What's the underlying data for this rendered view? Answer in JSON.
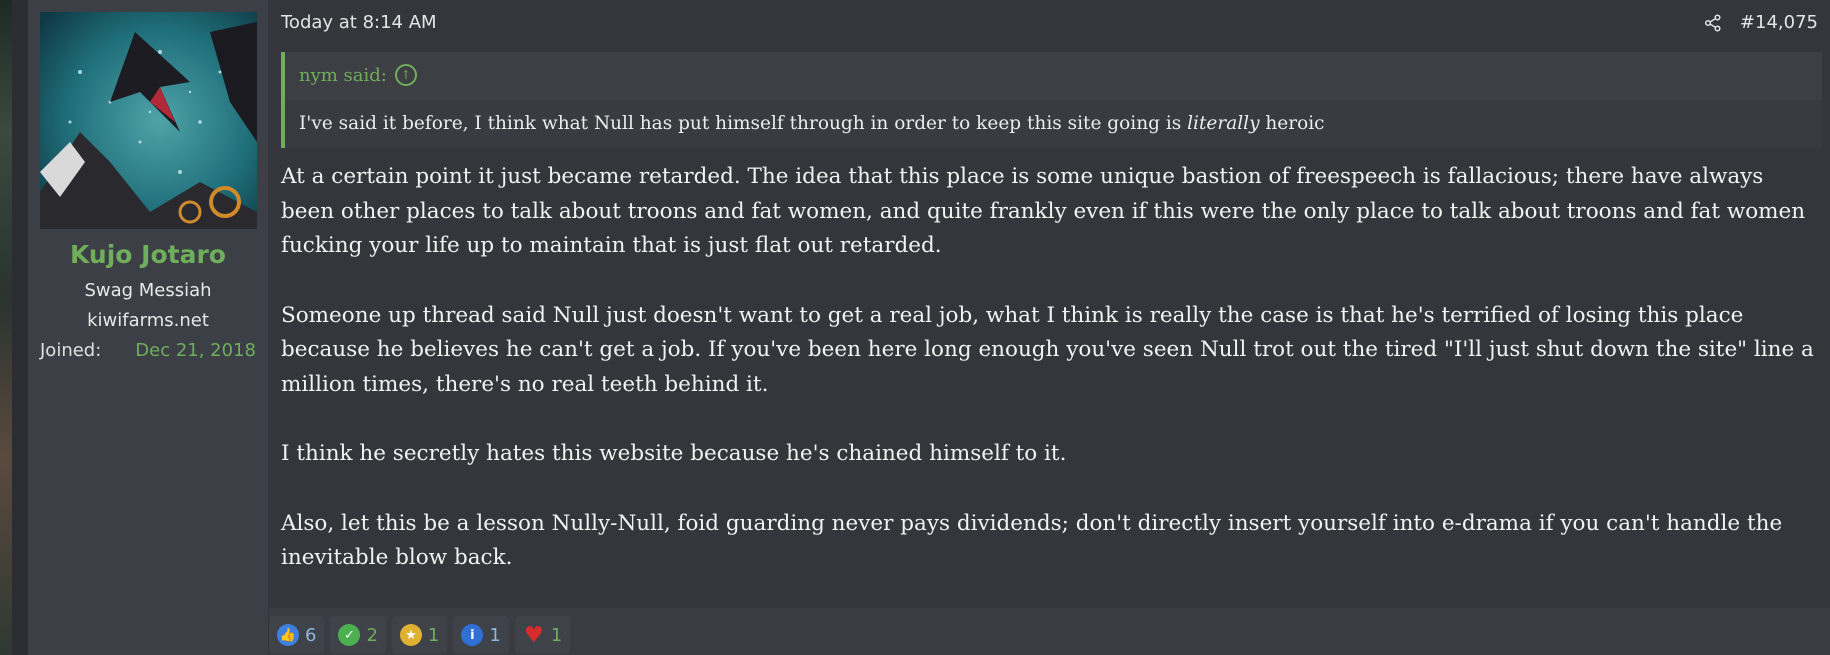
{
  "post": {
    "date": "Today at 8:14 AM",
    "number": "#14,075",
    "accent_color": "#6fae5a",
    "author": {
      "username": "Kujo Jotaro",
      "title": "Swag Messiah",
      "site": "kiwifarms.net",
      "joined_label": "Joined:",
      "joined_value": "Dec 21, 2018"
    },
    "quote": {
      "author_line": "nym said:",
      "text_before": "I've said it before, I think what Null has put himself through in order to keep this site going is ",
      "text_emph": "literally",
      "text_after": " heroic"
    },
    "paragraphs": [
      "At a certain point it just became retarded. The idea that this place is some unique bastion of freespeech is fallacious; there have always been other places to talk about troons and fat women, and quite frankly even if this were the only place to talk about troons and fat women fucking your life up to maintain that is just flat out retarded.",
      "Someone up thread said Null just doesn't want to get a real job, what I think is really the case is that he's terrified of losing this place because he believes he can't get a job. If you've been here long enough you've seen Null trot out the tired \"I'll just shut down the site\" line a million times, there's no real teeth behind it.",
      "I think he secretly hates this website because he's chained himself to it.",
      "Also, let this be a lesson Nully-Null, foid guarding never pays dividends; don't directly insert yourself into e-drama if you can't handle the inevitable blow back."
    ],
    "reactions": [
      {
        "icon": "thumbs-up-icon",
        "count": "6",
        "color": "#3b82e0"
      },
      {
        "icon": "checkmark-icon",
        "count": "2",
        "color": "#4caf50"
      },
      {
        "icon": "medal-icon",
        "count": "1",
        "color": "#e0b030"
      },
      {
        "icon": "info-icon",
        "count": "1",
        "color": "#2f6fd6"
      },
      {
        "icon": "heart-icon",
        "count": "1",
        "color": "#d62c2c"
      }
    ]
  }
}
